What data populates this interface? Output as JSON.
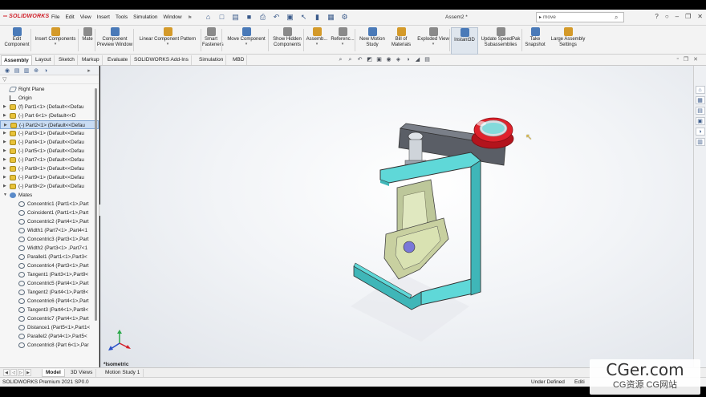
{
  "app": {
    "logo_text": "SOLIDWORKS",
    "doc_title": "Assem2 *"
  },
  "menu": [
    "File",
    "Edit",
    "View",
    "Insert",
    "Tools",
    "Simulation",
    "Window"
  ],
  "search": {
    "value": "move"
  },
  "ribbon": [
    {
      "label": "Edit\nComponent",
      "color": "#4a7ab8"
    },
    {
      "label": "Insert Components",
      "color": "#d49a2a"
    },
    {
      "label": "Mate",
      "color": "#8a8a8a"
    },
    {
      "label": "Component\nPreview Window",
      "color": "#4a7ab8"
    },
    {
      "label": "Linear Component Pattern",
      "color": "#d49a2a"
    },
    {
      "label": "Smart\nFasteners",
      "color": "#8a8a8a"
    },
    {
      "label": "Move Component",
      "color": "#4a7ab8"
    },
    {
      "label": "Show Hidden\nComponents",
      "color": "#8a8a8a"
    },
    {
      "label": "Assemb...",
      "color": "#d49a2a"
    },
    {
      "label": "Referenc...",
      "color": "#8a8a8a"
    },
    {
      "label": "New Motion\nStudy",
      "color": "#4a7ab8"
    },
    {
      "label": "Bill of\nMaterials",
      "color": "#d49a2a"
    },
    {
      "label": "Exploded View",
      "color": "#8a8a8a"
    },
    {
      "label": "Instant3D",
      "color": "#4a7ab8"
    },
    {
      "label": "Update SpeedPak\nSubassemblies",
      "color": "#8a8a8a"
    },
    {
      "label": "Take\nSnapshot",
      "color": "#4a7ab8"
    },
    {
      "label": "Large Assembly\nSettings",
      "color": "#d49a2a"
    }
  ],
  "tabs": [
    "Assembly",
    "Layout",
    "Sketch",
    "Markup",
    "Evaluate",
    "SOLIDWORKS Add-Ins",
    "Simulation",
    "MBD"
  ],
  "tree": [
    {
      "label": "Right Plane",
      "icon": "plane",
      "exp": ""
    },
    {
      "label": "Origin",
      "icon": "origin",
      "exp": ""
    },
    {
      "label": "(f) Part1<1> (Default<<Defau",
      "icon": "part",
      "exp": "▶"
    },
    {
      "label": "(-) Part 6<1> (Default<<D",
      "icon": "part",
      "exp": "▶"
    },
    {
      "label": "(-) Part2<1> (Default<<Defau",
      "icon": "part",
      "exp": "▶",
      "selected": true
    },
    {
      "label": "(-) Part3<1> (Default<<Defau",
      "icon": "part",
      "exp": "▶"
    },
    {
      "label": "(-) Part4<1> (Default<<Defau",
      "icon": "part",
      "exp": "▶"
    },
    {
      "label": "(-) Part5<1> (Default<<Defau",
      "icon": "part",
      "exp": "▶"
    },
    {
      "label": "(-) Part7<1> (Default<<Defau",
      "icon": "part",
      "exp": "▶"
    },
    {
      "label": "(-) Part8<1> (Default<<Defau",
      "icon": "part",
      "exp": "▶"
    },
    {
      "label": "(-) Part9<1> (Default<<Defau",
      "icon": "part",
      "exp": "▶"
    },
    {
      "label": "(-) Part8<2> (Default<<Defau",
      "icon": "part",
      "exp": "▶"
    },
    {
      "label": "Mates",
      "icon": "mates",
      "exp": "▼"
    },
    {
      "label": "Concentric1 (Part1<1>,Part",
      "icon": "mate",
      "exp": ""
    },
    {
      "label": "Coincident1 (Part1<1>,Part",
      "icon": "mate",
      "exp": ""
    },
    {
      "label": "Concentric2 (Part4<1>,Part",
      "icon": "mate",
      "exp": ""
    },
    {
      "label": "Width1 (Part7<1> ,Part4<1",
      "icon": "mate",
      "exp": ""
    },
    {
      "label": "Concentric3 (Part3<1>,Part",
      "icon": "mate",
      "exp": ""
    },
    {
      "label": "Width2 (Part3<1> ,Part7<1",
      "icon": "mate",
      "exp": ""
    },
    {
      "label": "Parallel1 (Part1<1>,Part3<",
      "icon": "mate",
      "exp": ""
    },
    {
      "label": "Concentric4 (Part3<1>,Part",
      "icon": "mate",
      "exp": ""
    },
    {
      "label": "Tangent1 (Part3<1>,Part9<",
      "icon": "mate",
      "exp": ""
    },
    {
      "label": "Concentric5 (Part4<1>,Part",
      "icon": "mate",
      "exp": ""
    },
    {
      "label": "Tangent2 (Part4<1>,Part8<",
      "icon": "mate",
      "exp": ""
    },
    {
      "label": "Concentric6 (Part4<1>,Part",
      "icon": "mate",
      "exp": ""
    },
    {
      "label": "Tangent3 (Part4<1>,Part8<",
      "icon": "mate",
      "exp": ""
    },
    {
      "label": "Concentric7 (Part4<1>,Part",
      "icon": "mate",
      "exp": ""
    },
    {
      "label": "Distance1 (Part5<1>,Part1<",
      "icon": "mate",
      "exp": ""
    },
    {
      "label": "Parallel2 (Part4<1>,Part5<",
      "icon": "mate",
      "exp": ""
    },
    {
      "label": "Concentric8 (Part 6<1>,Par",
      "icon": "mate",
      "exp": ""
    }
  ],
  "viewport": {
    "view_label": "*Isometric"
  },
  "bottom_tabs": [
    "Model",
    "3D Views",
    "Motion Study 1"
  ],
  "status": {
    "left": "SOLIDWORKS Premium 2021 SP0.0",
    "mid": "Under Defined",
    "edit": "Editi"
  },
  "watermark": {
    "main": "CGer.com",
    "sub": "CG资源 CG网站"
  },
  "colors": {
    "accent": "#5fd8d8",
    "part_yellow": "#e8c23a",
    "button_red": "#d4202a"
  }
}
